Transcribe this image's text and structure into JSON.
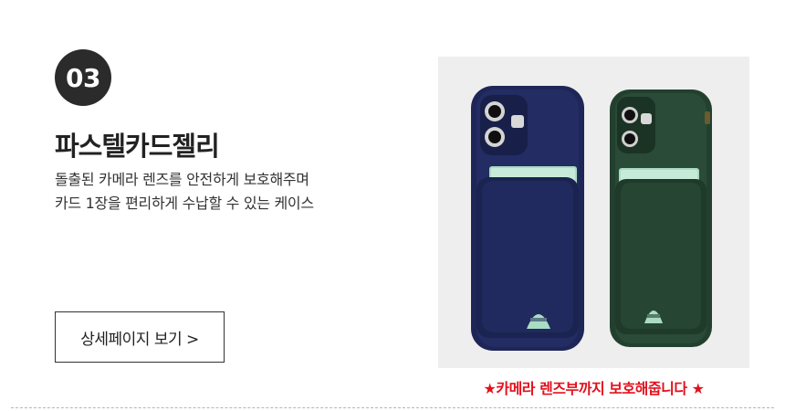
{
  "section": {
    "number": "03",
    "title": "파스텔카드젤리",
    "description_lines": [
      "돌출된 카메라 렌즈를 안전하게 보호해주며",
      "카드 1장을 편리하게 수납할 수 있는 케이스"
    ],
    "detail_button_label": "상세페이지 보기 >"
  },
  "product_image": {
    "caption": "★카메라 렌즈부까지 보호해줍니다 ★",
    "case_colors": [
      "#1e2657",
      "#23402f"
    ],
    "card_color": "#a9dcc4"
  },
  "colors": {
    "badge": "#2b2b2b",
    "caption": "#e3101c",
    "photo_background": "#eeeeee"
  }
}
